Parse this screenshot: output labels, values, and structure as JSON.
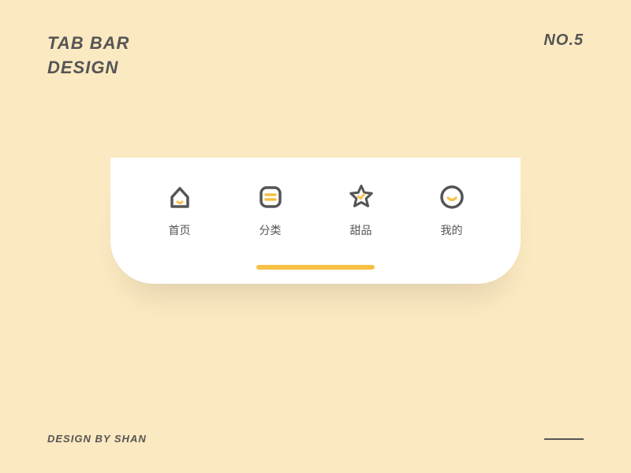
{
  "header": {
    "title_line1": "TAB BAR",
    "title_line2": "DESIGN",
    "page_number": "NO.5"
  },
  "tabbar": {
    "items": [
      {
        "label": "首页",
        "icon": "home"
      },
      {
        "label": "分类",
        "icon": "category"
      },
      {
        "label": "甜品",
        "icon": "star"
      },
      {
        "label": "我的",
        "icon": "profile"
      }
    ],
    "accent_color": "#f6c044",
    "icon_stroke": "#555555"
  },
  "footer": {
    "credit": "DESIGN BY SHAN"
  }
}
